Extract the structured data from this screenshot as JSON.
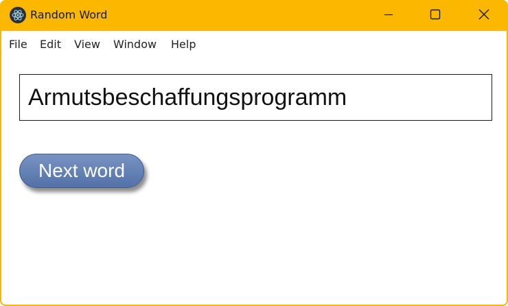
{
  "window": {
    "title": "Random Word",
    "app_icon": "electron-icon",
    "controls": {
      "minimize": "minimize-icon",
      "maximize": "maximize-icon",
      "close": "close-icon"
    },
    "accent_color": "#fcb800"
  },
  "menubar": {
    "items": [
      {
        "label": "File"
      },
      {
        "label": "Edit"
      },
      {
        "label": "View"
      },
      {
        "label": "Window"
      },
      {
        "label": "Help"
      }
    ]
  },
  "main": {
    "word": "Armutsbeschaffungsprogramm",
    "next_button_label": "Next word",
    "button_color": "#5f7eb4"
  }
}
